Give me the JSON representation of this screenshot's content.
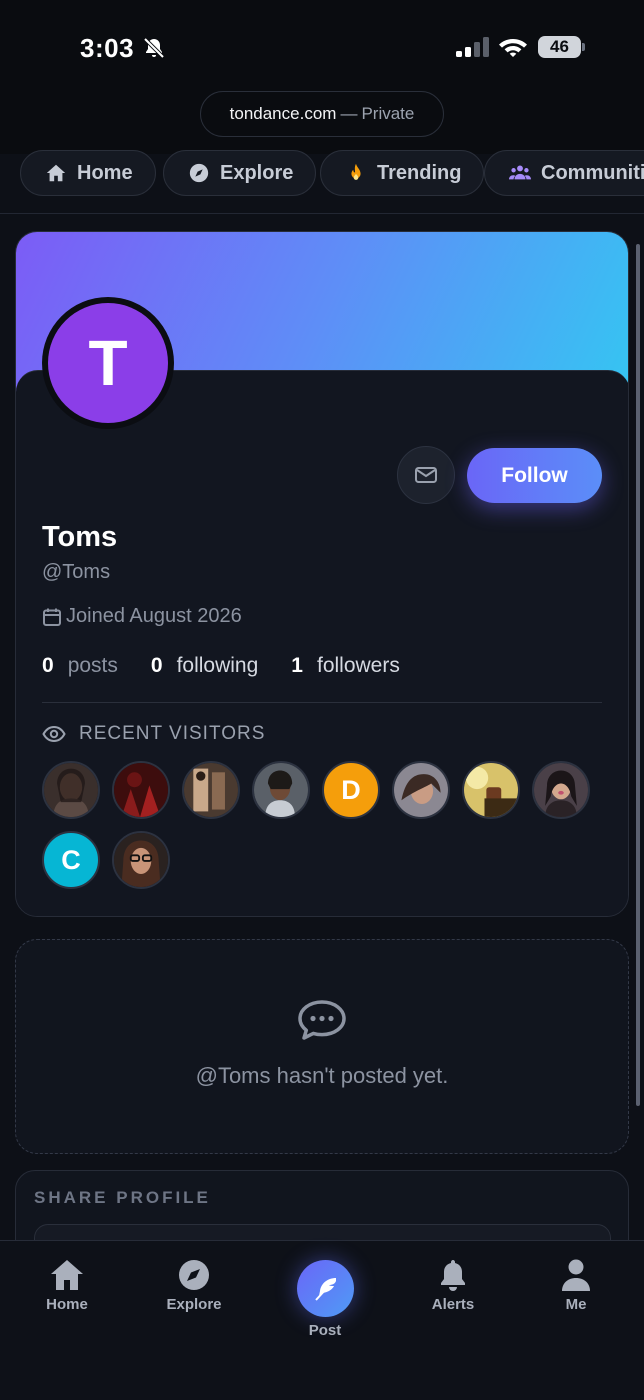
{
  "status_bar": {
    "time": "3:03",
    "battery": "46"
  },
  "browser": {
    "domain": "tondance.com",
    "separator": "—",
    "mode": "Private"
  },
  "top_nav": {
    "tabs": [
      {
        "label": "Home",
        "icon": "home-icon"
      },
      {
        "label": "Explore",
        "icon": "compass-icon"
      },
      {
        "label": "Trending",
        "icon": "flame-icon"
      },
      {
        "label": "Communities",
        "icon": "users-icon"
      }
    ]
  },
  "profile": {
    "avatar_letter": "T",
    "name": "Toms",
    "handle": "@Toms",
    "joined": "Joined August 2026",
    "follow_label": "Follow",
    "stats": [
      {
        "value": "0",
        "label": "posts"
      },
      {
        "value": "0",
        "label": "following"
      },
      {
        "value": "1",
        "label": "followers"
      }
    ],
    "visitors_title": "RECENT VISITORS",
    "visitors": [
      {
        "type": "photo",
        "color": "#5b4a44"
      },
      {
        "type": "photo",
        "color": "#7a1a1a"
      },
      {
        "type": "photo",
        "color": "#8a6a52"
      },
      {
        "type": "photo",
        "color": "#4a4f58"
      },
      {
        "type": "letter",
        "letter": "D",
        "color": "#f59e0b"
      },
      {
        "type": "photo",
        "color": "#6a6670"
      },
      {
        "type": "photo",
        "color": "#b89a3a"
      },
      {
        "type": "photo",
        "color": "#3a3238"
      },
      {
        "type": "letter",
        "letter": "C",
        "color": "#06b6d4"
      },
      {
        "type": "photo",
        "color": "#6b4a3e"
      }
    ]
  },
  "posts": {
    "empty_text": "@Toms hasn't posted yet."
  },
  "share": {
    "title": "SHARE PROFILE"
  },
  "bottom_nav": {
    "items": [
      {
        "label": "Home",
        "icon": "home-icon"
      },
      {
        "label": "Explore",
        "icon": "compass-icon"
      },
      {
        "label": "Post",
        "icon": "feather-icon"
      },
      {
        "label": "Alerts",
        "icon": "bell-icon"
      },
      {
        "label": "Me",
        "icon": "person-icon"
      }
    ]
  },
  "colors": {
    "background": "#0d1017",
    "card": "#121620",
    "accent": "#6a66f7",
    "banner_start": "#7c5cf6",
    "banner_end": "#35c5f2",
    "avatar": "#8b3ee8"
  }
}
